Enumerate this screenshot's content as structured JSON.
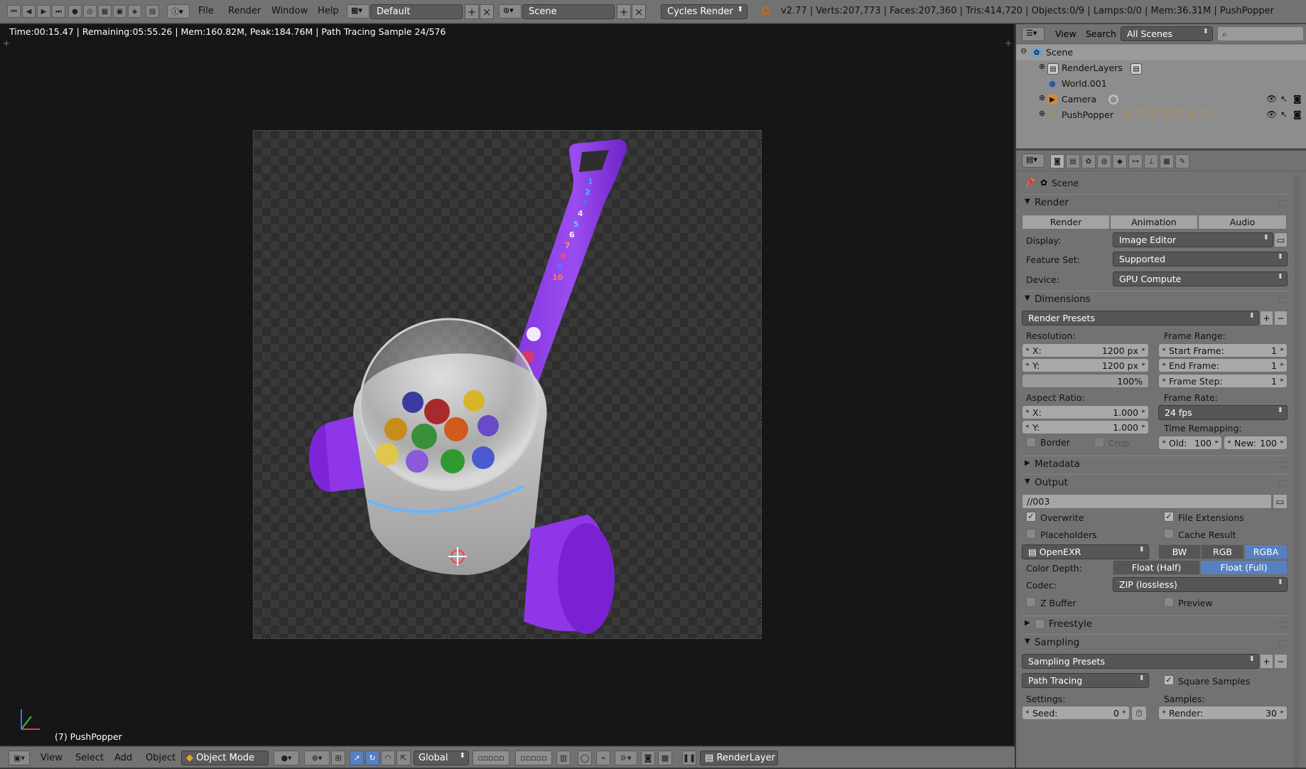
{
  "header": {
    "menus": [
      "File",
      "Render",
      "Window",
      "Help"
    ],
    "screen_layout": "Default",
    "scene": "Scene",
    "engine": "Cycles Render",
    "stats": "v2.77 | Verts:207,773 | Faces:207,360 | Tris:414,720 | Objects:0/9 | Lamps:0/0 | Mem:36.31M | PushPopper"
  },
  "viewport": {
    "render_info": "Time:00:15.47 | Remaining:05:55.26 | Mem:160.82M, Peak:184.76M | Path Tracing Sample 24/576",
    "object_label": "(7) PushPopper",
    "handle_numbers": [
      "1",
      "2",
      "3",
      "4",
      "5",
      "6",
      "7",
      "8",
      "9",
      "10"
    ]
  },
  "bottom_bar": {
    "menus": [
      "View",
      "Select",
      "Add",
      "Object"
    ],
    "mode": "Object Mode",
    "orientation": "Global",
    "render_layer": "RenderLayer"
  },
  "outliner": {
    "view": "View",
    "search": "Search",
    "filter": "All Scenes",
    "items": [
      {
        "label": "Scene",
        "indent": 0
      },
      {
        "label": "RenderLayers",
        "indent": 1
      },
      {
        "label": "World.001",
        "indent": 1
      },
      {
        "label": "Camera",
        "indent": 1
      },
      {
        "label": "PushPopper",
        "indent": 1
      }
    ]
  },
  "properties": {
    "context": "Scene",
    "render": {
      "title": "Render",
      "btn_render": "Render",
      "btn_animation": "Animation",
      "btn_audio": "Audio",
      "display_label": "Display:",
      "display": "Image Editor",
      "feature_label": "Feature Set:",
      "feature": "Supported",
      "device_label": "Device:",
      "device": "GPU Compute"
    },
    "dimensions": {
      "title": "Dimensions",
      "presets": "Render Presets",
      "resolution_label": "Resolution:",
      "res_x_label": "X:",
      "res_x": "1200 px",
      "res_y_label": "Y:",
      "res_y": "1200 px",
      "res_pct": "100%",
      "frame_range_label": "Frame Range:",
      "start_label": "Start Frame:",
      "start": "1",
      "end_label": "End Frame:",
      "end": "1",
      "step_label": "Frame Step:",
      "step": "1",
      "aspect_label": "Aspect Ratio:",
      "asp_x_label": "X:",
      "asp_x": "1.000",
      "asp_y_label": "Y:",
      "asp_y": "1.000",
      "frame_rate_label": "Frame Rate:",
      "frame_rate": "24 fps",
      "time_remap_label": "Time Remapping:",
      "old_label": "Old:",
      "old": "100",
      "new_label": "New:",
      "new": "100",
      "border": "Border",
      "crop": "Crop"
    },
    "metadata": {
      "title": "Metadata"
    },
    "output": {
      "title": "Output",
      "path": "//003",
      "overwrite": "Overwrite",
      "file_ext": "File Extensions",
      "placeholders": "Placeholders",
      "cache": "Cache Result",
      "format": "OpenEXR",
      "bw": "BW",
      "rgb": "RGB",
      "rgba": "RGBA",
      "depth_label": "Color Depth:",
      "half": "Float (Half)",
      "full": "Float (Full)",
      "codec_label": "Codec:",
      "codec": "ZIP (lossless)",
      "zbuffer": "Z Buffer",
      "preview": "Preview"
    },
    "freestyle": {
      "title": "Freestyle"
    },
    "sampling": {
      "title": "Sampling",
      "presets": "Sampling Presets",
      "method": "Path Tracing",
      "square": "Square Samples",
      "settings_label": "Settings:",
      "samples_label": "Samples:",
      "seed_label": "Seed:",
      "seed": "0",
      "render_label": "Render:",
      "render": "30"
    }
  },
  "colors": {
    "accent": "#5680c2",
    "toy_purple": "#8a2be2",
    "header_bg": "#727272"
  }
}
